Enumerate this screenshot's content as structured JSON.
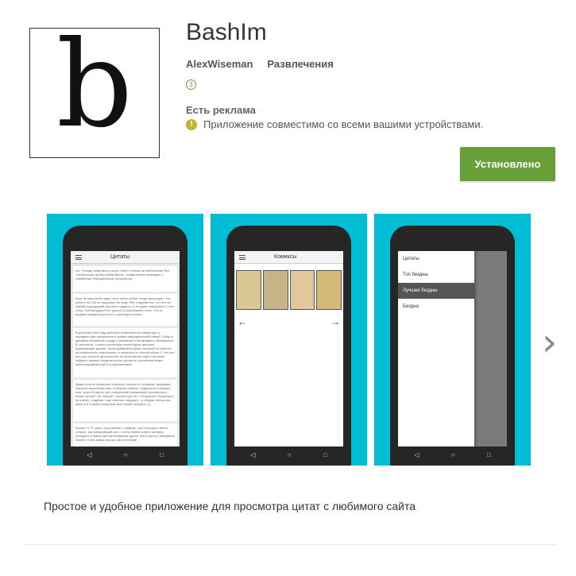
{
  "app": {
    "icon_letter": "b",
    "title": "BashIm",
    "developer": "AlexWiseman",
    "category": "Развлечения",
    "rating_badge": "3",
    "ads_label": "Есть реклама",
    "compat_text": "Приложение совместимо со всеми вашими устройствами.",
    "install_label": "Установлено",
    "description": "Простое и удобное приложение для просмотра цитат с любимого сайта"
  },
  "screenshots": {
    "quotes": {
      "title": "Цитаты",
      "cards": [
        "кот. Поезду смартфону скоро станет тоскаю на мобильнике без «небольшая трубка (смартфон)». соединенная проводом с указанным чемоданчиком (гонорбаля).",
        "Муж не переносит жару, хоть очень любит, когда прохладно. На работу на 23е он подарили по ходу. Мне подумалось, что это на самый подходящий для него подарок. А он даже заморожен и этот след. Поблагодарил его руки (2) и захихикали стать. Что ж, видимо подарок для него в прохлад полном»...",
        "В далеком 1992 году военные испанские реставраторы в середине уже прекратили в храме кафедральный Новый Собор в древнем испанском городе Саламанка и неожиданно обнаружили. В частности, а многочисленные скульптурах фигурах, украшающих здание, была добавлены фаза, похожей мгновенно на кафельного стакольника, а коснуться в полной образ. С тех пор вот уже которое десятилетие по интернетам ходит гипотеза: найдено прямое свидетельство контакта с инопланетными цивилизациями ещё в средневековье!",
        "Девиз хотели позвонить телефон, искали по отзывам, форумам, изучали характеристики, поискали советы. Подкатила в нужную мне, скоро 8 марта, вот телефончик показанный просмотреть, может купим? Ну, говорит, похоже щас это. Посиделки. Посмотрел, прочитал, подумал, еще немного подумал... в общем теперь мы вместе в 8 марта покупаем мне новый телефон :))",
        "Фокиа! «« Я, рука, хочу мелкие с замком, части которого были острые, как самурайский меч. Чтобы любая кофта, которая попадает в замок при застегивании куртки, была просто разорвана нафиг, чтобы замок рассек, как отличный"
      ]
    },
    "comics": {
      "title": "Комиксы",
      "prev_arrow": "←",
      "next_arrow": "→"
    },
    "drawer": {
      "items": [
        "Цитаты",
        "Топ бездны",
        "Лучшее бездны",
        "Бездна"
      ],
      "active_index": 2
    },
    "nav_back": "◁",
    "nav_home": "○",
    "nav_recent": "□"
  },
  "next_arrow": "›"
}
